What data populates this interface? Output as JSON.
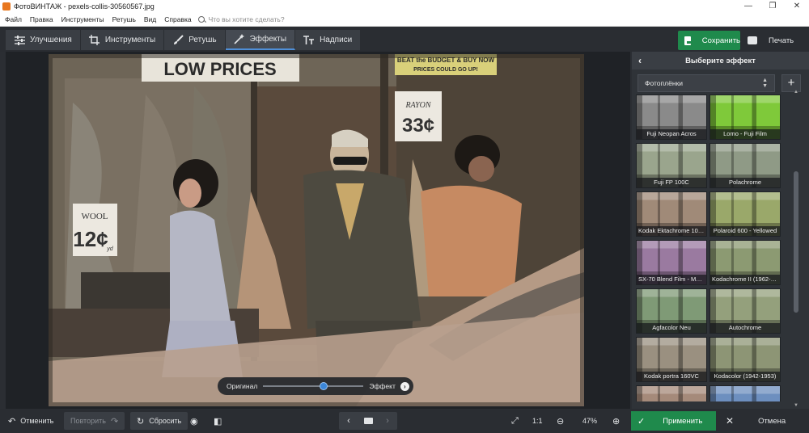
{
  "window": {
    "title": "ФотоВИНТАЖ - pexels-collis-30560567.jpg",
    "minimize": "—",
    "maximize": "❐",
    "close": "✕"
  },
  "menu": {
    "items": [
      "Файл",
      "Правка",
      "Инструменты",
      "Ретушь",
      "Вид",
      "Справка"
    ],
    "search_placeholder": "Что вы хотите сделать?"
  },
  "toolbar": {
    "tabs": [
      {
        "label": "Улучшения",
        "icon": "sliders-icon",
        "active": false
      },
      {
        "label": "Инструменты",
        "icon": "crop-icon",
        "active": false
      },
      {
        "label": "Ретушь",
        "icon": "brush-icon",
        "active": false
      },
      {
        "label": "Эффекты",
        "icon": "magic-wand-icon",
        "active": true
      },
      {
        "label": "Надписи",
        "icon": "text-icon",
        "active": false
      }
    ],
    "save_label": "Сохранить",
    "print_label": "Печать"
  },
  "photo": {
    "sign_low_prices": "LOW PRICES",
    "sign_budget_line1": "BEAT the BUDGET & BUY NOW",
    "sign_budget_line2": "PRICES COULD GO UP!",
    "sign_rayon": "RAYON",
    "sign_rayon_price": "33¢",
    "sign_wool": "WOOL",
    "sign_wool_price": "12¢",
    "sign_wool_unit": "yd"
  },
  "compare": {
    "original_label": "Оригинал",
    "effect_label": "Эффект",
    "position_percent": 60
  },
  "panel": {
    "title": "Выберите эффект",
    "category": "Фотоплёнки",
    "effects": [
      {
        "name": "Fuji Neopan Acros",
        "tint": "#8a8a8a"
      },
      {
        "name": "Lomo - Fuji Film",
        "tint": "#7fc93a"
      },
      {
        "name": "Fuji FP 100C",
        "tint": "#9aa58d"
      },
      {
        "name": "Polachrome",
        "tint": "#8f9a86"
      },
      {
        "name": "Kodak Ektachrome 100G",
        "tint": "#a08a78"
      },
      {
        "name": "Polaroid 600 - Yellowed",
        "tint": "#9aa86a"
      },
      {
        "name": "SX-70 Blend Film - Mag...",
        "tint": "#9a7aa0"
      },
      {
        "name": "Kodachrome II (1962-1...",
        "tint": "#8c9a72"
      },
      {
        "name": "Agfacolor Neu",
        "tint": "#7f9a76"
      },
      {
        "name": "Autochrome",
        "tint": "#94a07c"
      },
      {
        "name": "Kodak portra 160VC",
        "tint": "#9a9080"
      },
      {
        "name": "Kodacolor (1942-1953)",
        "tint": "#8d9575"
      },
      {
        "name": "",
        "tint": "#a58a7a"
      },
      {
        "name": "",
        "tint": "#6d8fbf"
      }
    ]
  },
  "bottom": {
    "undo_label": "Отменить",
    "redo_label": "Повторить",
    "reset_label": "Сбросить",
    "zoom_1to1": "1:1",
    "zoom_value": "47%",
    "apply_label": "Применить",
    "cancel_label": "Отмена"
  },
  "colors": {
    "accent_green": "#1f8a4c",
    "accent_blue": "#4f8fd8",
    "background": "#2b2e33"
  }
}
